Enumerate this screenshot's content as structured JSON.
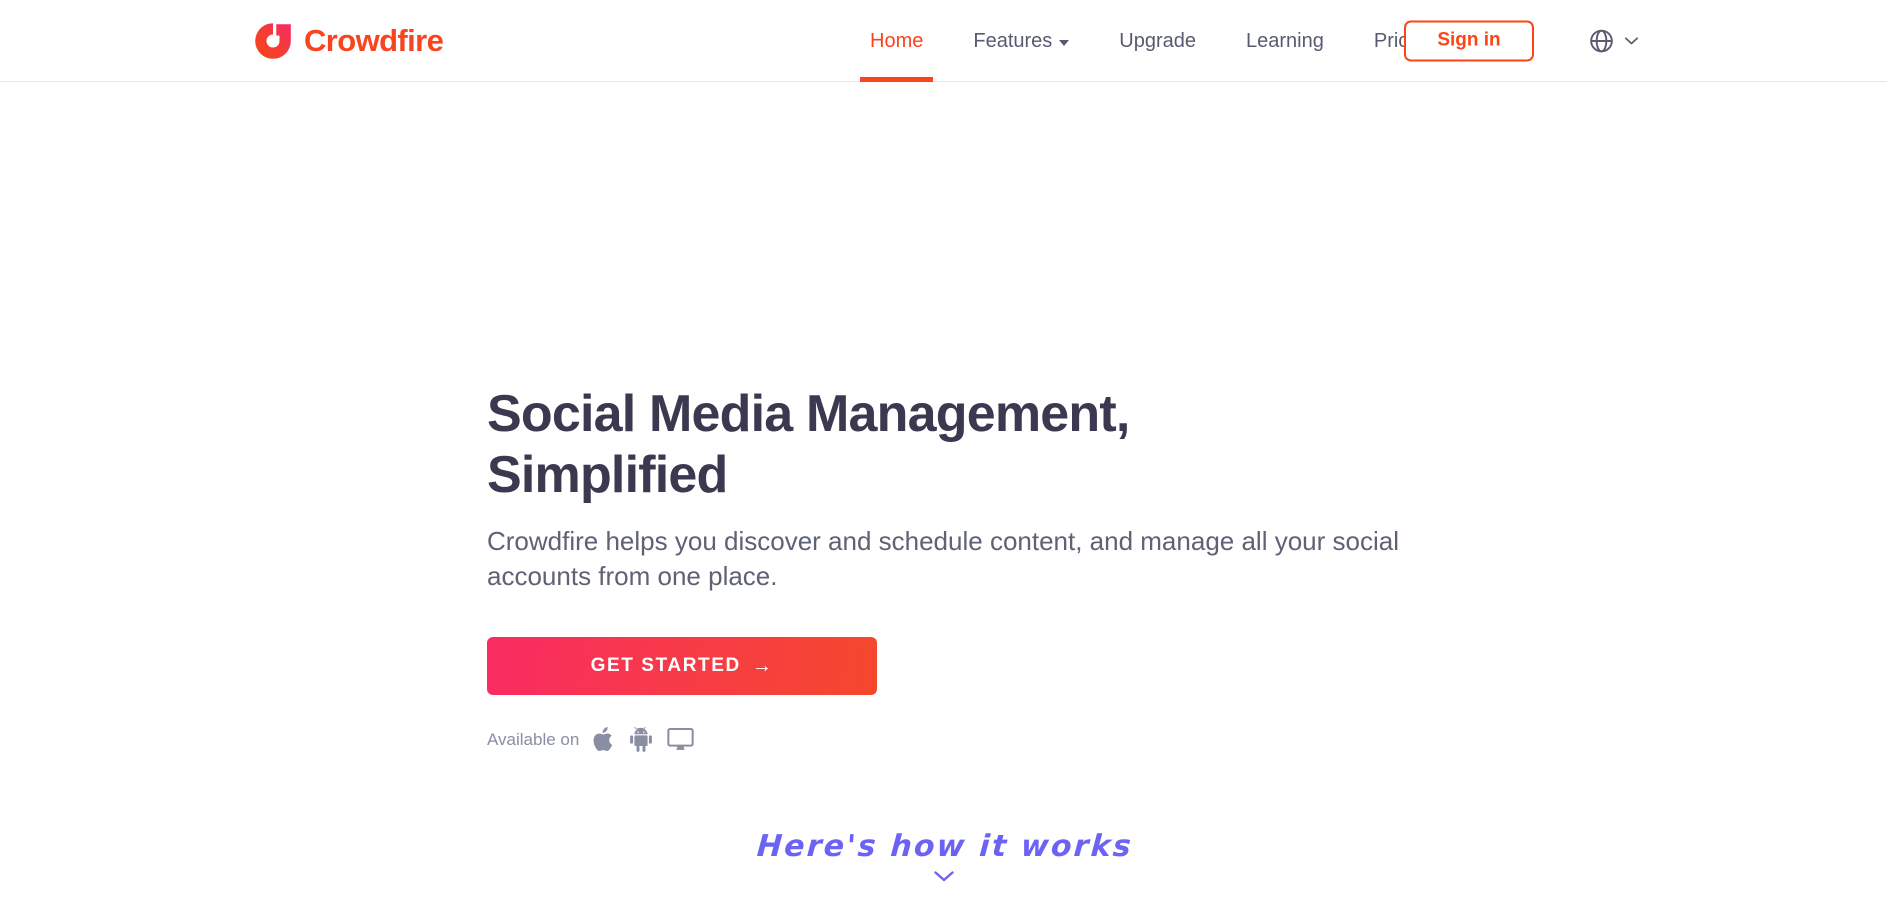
{
  "header": {
    "brand": {
      "name": "Crowdfire",
      "logo_icon": "crowdfire-circle-logo",
      "color": "#f9441f"
    },
    "nav": [
      {
        "label": "Home",
        "active": true,
        "has_dropdown": false,
        "name": "home"
      },
      {
        "label": "Features",
        "active": false,
        "has_dropdown": true,
        "name": "features"
      },
      {
        "label": "Upgrade",
        "active": false,
        "has_dropdown": false,
        "name": "upgrade"
      },
      {
        "label": "Learning",
        "active": false,
        "has_dropdown": false,
        "name": "learning"
      },
      {
        "label": "Pricing",
        "active": false,
        "has_dropdown": false,
        "name": "pricing"
      }
    ],
    "signin_label": "Sign in",
    "language_switcher": {
      "icon": "globe-icon",
      "caret_icon": "chevron-down-icon"
    }
  },
  "hero": {
    "title_line1": "Social Media Management,",
    "title_line2": "Simplified",
    "subtitle": "Crowdfire helps you discover and schedule content, and manage all your social accounts from one place.",
    "cta_label": "GET STARTED",
    "cta_arrow": "→",
    "available_label": "Available on",
    "platforms": [
      {
        "name": "apple",
        "icon": "apple-icon"
      },
      {
        "name": "android",
        "icon": "android-icon"
      },
      {
        "name": "desktop",
        "icon": "desktop-monitor-icon"
      }
    ],
    "how_it_works_label": "Here's how it works",
    "how_it_works_chevron": "chevron-down-icon"
  },
  "colors": {
    "brand_orange": "#f9441f",
    "cta_gradient_from": "#f92b63",
    "cta_gradient_to": "#f4482c",
    "heading": "#3b3850",
    "body_text": "#5f6275",
    "muted": "#8a8ea3",
    "accent_purple": "#6c63f5"
  }
}
